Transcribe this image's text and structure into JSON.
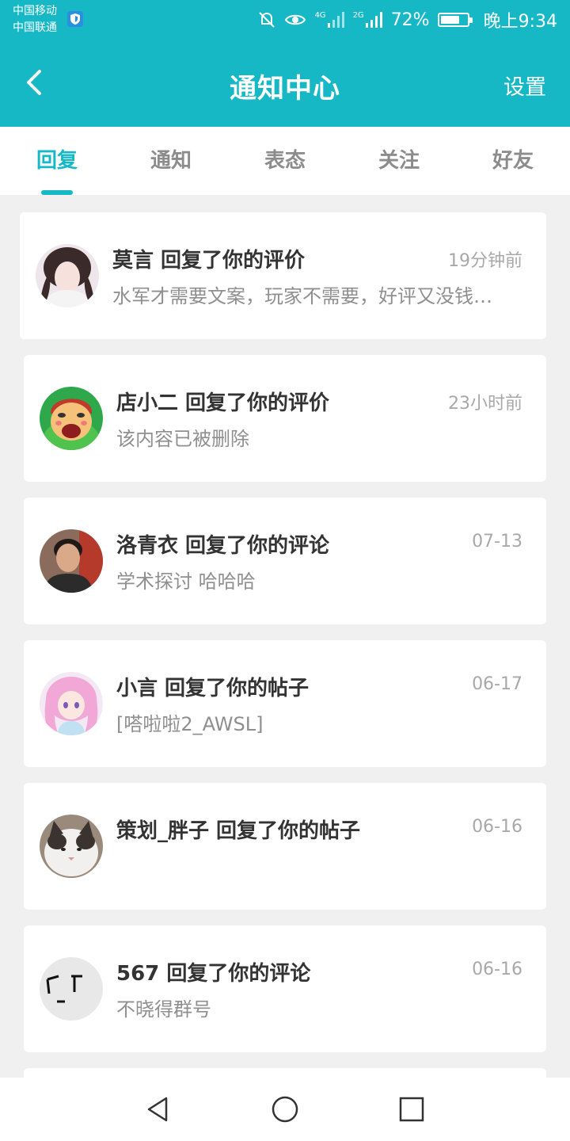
{
  "status_bar": {
    "carrier_1": "中国移动",
    "carrier_2": "中国联通",
    "net_1": "4G",
    "net_2": "2G",
    "battery": "72%",
    "time": "晚上9:34",
    "battery_level": 0.72
  },
  "nav": {
    "title": "通知中心",
    "settings_label": "设置"
  },
  "tabs": [
    {
      "label": "回复",
      "active": true
    },
    {
      "label": "通知",
      "active": false
    },
    {
      "label": "表态",
      "active": false
    },
    {
      "label": "关注",
      "active": false
    },
    {
      "label": "好友",
      "active": false
    }
  ],
  "notifications": [
    {
      "title": "莫言 回复了你的评价",
      "time": "19分钟前",
      "body": "水军才需要文案，玩家不需要，好评又没钱…"
    },
    {
      "title": "店小二 回复了你的评价",
      "time": "23小时前",
      "body": "该内容已被删除"
    },
    {
      "title": "洛青衣 回复了你的评论",
      "time": "07-13",
      "body": "学术探讨 哈哈哈"
    },
    {
      "title": "小言 回复了你的帖子",
      "time": "06-17",
      "body": "[嗒啦啦2_AWSL]"
    },
    {
      "title": "策划_胖子 回复了你的帖子",
      "time": "06-16",
      "body": ""
    },
    {
      "title": "567 回复了你的评论",
      "time": "06-16",
      "body": "不晓得群号"
    }
  ],
  "colors": {
    "accent": "#17b8c6",
    "background": "#f0f0f0"
  }
}
